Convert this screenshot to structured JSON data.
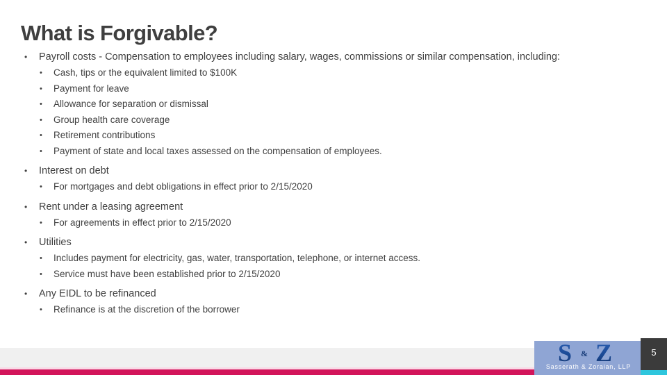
{
  "slide": {
    "title": "What is Forgivable?",
    "page_number": "5",
    "colors": {
      "title_text": "#3f3f3f",
      "body_text": "#3f3f3f",
      "footer_bar": "#d2145a",
      "footer_band": "#f0f0f0",
      "logo_panel": "#8fa5d4",
      "logo_blue": "#1f4e9c",
      "pagenum_block": "#3b3b3b",
      "pagenum_accent": "#2ec6dd"
    }
  },
  "content": {
    "bullets": [
      {
        "level": 1,
        "text": "Payroll costs - Compensation to employees including salary, wages, commissions or similar compensation, including:"
      },
      {
        "level": 2,
        "text": "Cash, tips or the equivalent limited to $100K"
      },
      {
        "level": 2,
        "text": "Payment for leave"
      },
      {
        "level": 2,
        "text": "Allowance for separation or dismissal"
      },
      {
        "level": 2,
        "text": "Group health care coverage"
      },
      {
        "level": 2,
        "text": "Retirement contributions"
      },
      {
        "level": 2,
        "text": "Payment of state and local taxes assessed on the compensation of employees."
      },
      {
        "level": 1,
        "text": "Interest on debt"
      },
      {
        "level": 2,
        "text": "For mortgages and debt obligations in effect prior to 2/15/2020"
      },
      {
        "level": 1,
        "text": "Rent under a leasing agreement"
      },
      {
        "level": 2,
        "text": "For agreements in effect prior to 2/15/2020"
      },
      {
        "level": 1,
        "text": "Utilities"
      },
      {
        "level": 2,
        "text": "Includes payment for electricity, gas, water, transportation, telephone, or internet access."
      },
      {
        "level": 2,
        "text": "Service must have been established prior to 2/15/2020"
      },
      {
        "level": 1,
        "text": "Any EIDL to be refinanced"
      },
      {
        "level": 2,
        "text": "Refinance is at the discretion of the borrower"
      }
    ],
    "bullet_marker": "•"
  },
  "logo": {
    "monogram_left": "S",
    "monogram_ampersand": "&",
    "monogram_right": "Z",
    "caption": "Sasserath & Zoraian, LLP"
  }
}
